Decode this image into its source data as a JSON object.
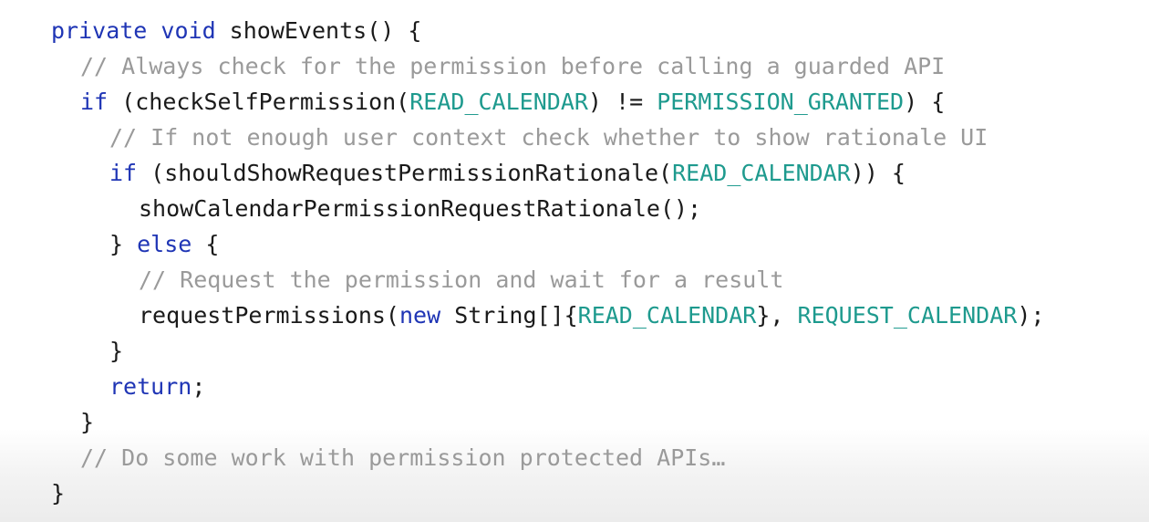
{
  "code_lines": [
    {
      "indent": 0,
      "kind": "code",
      "tokens": [
        {
          "type": "kw",
          "text": "private void"
        },
        {
          "type": "tx",
          "text": " showEvents() {"
        }
      ]
    },
    {
      "indent": 1,
      "kind": "comment",
      "tokens": [
        {
          "type": "cm",
          "text": "// Always check for the permission before calling a guarded API"
        }
      ]
    },
    {
      "indent": 1,
      "kind": "code",
      "tokens": [
        {
          "type": "kw",
          "text": "if"
        },
        {
          "type": "tx",
          "text": " (checkSelfPermission("
        },
        {
          "type": "cn",
          "text": "READ_CALENDAR"
        },
        {
          "type": "tx",
          "text": ") != "
        },
        {
          "type": "cn",
          "text": "PERMISSION_GRANTED"
        },
        {
          "type": "tx",
          "text": ") {"
        }
      ]
    },
    {
      "indent": 2,
      "kind": "comment",
      "tokens": [
        {
          "type": "cm",
          "text": "// If not enough user context check whether to show rationale UI"
        }
      ]
    },
    {
      "indent": 2,
      "kind": "code",
      "tokens": [
        {
          "type": "kw",
          "text": "if"
        },
        {
          "type": "tx",
          "text": " (shouldShowRequestPermissionRationale("
        },
        {
          "type": "cn",
          "text": "READ_CALENDAR"
        },
        {
          "type": "tx",
          "text": ")) {"
        }
      ]
    },
    {
      "indent": 3,
      "kind": "code",
      "tokens": [
        {
          "type": "tx",
          "text": "showCalendarPermissionRequestRationale();"
        }
      ]
    },
    {
      "indent": 2,
      "kind": "code",
      "tokens": [
        {
          "type": "tx",
          "text": "} "
        },
        {
          "type": "kw",
          "text": "else"
        },
        {
          "type": "tx",
          "text": " {"
        }
      ]
    },
    {
      "indent": 3,
      "kind": "comment",
      "tokens": [
        {
          "type": "cm",
          "text": "// Request the permission and wait for a result"
        }
      ]
    },
    {
      "indent": 3,
      "kind": "code",
      "tokens": [
        {
          "type": "tx",
          "text": "requestPermissions("
        },
        {
          "type": "kw",
          "text": "new"
        },
        {
          "type": "tx",
          "text": " String[]{"
        },
        {
          "type": "cn",
          "text": "READ_CALENDAR"
        },
        {
          "type": "tx",
          "text": "}, "
        },
        {
          "type": "cn",
          "text": "REQUEST_CALENDAR"
        },
        {
          "type": "tx",
          "text": ");"
        }
      ]
    },
    {
      "indent": 2,
      "kind": "code",
      "tokens": [
        {
          "type": "tx",
          "text": "}"
        }
      ]
    },
    {
      "indent": 2,
      "kind": "code",
      "tokens": [
        {
          "type": "kw",
          "text": "return"
        },
        {
          "type": "tx",
          "text": ";"
        }
      ]
    },
    {
      "indent": 1,
      "kind": "code",
      "tokens": [
        {
          "type": "tx",
          "text": "}"
        }
      ]
    },
    {
      "indent": 1,
      "kind": "comment",
      "tokens": [
        {
          "type": "cm",
          "text": "// Do some work with permission protected APIs…"
        }
      ]
    },
    {
      "indent": 0,
      "kind": "code",
      "tokens": [
        {
          "type": "tx",
          "text": "}"
        }
      ]
    }
  ],
  "colors": {
    "keyword": "#1f35b5",
    "constant": "#1e9a8e",
    "comment": "#9a9a9a",
    "text": "#1a1a1a",
    "background": "#ffffff"
  }
}
